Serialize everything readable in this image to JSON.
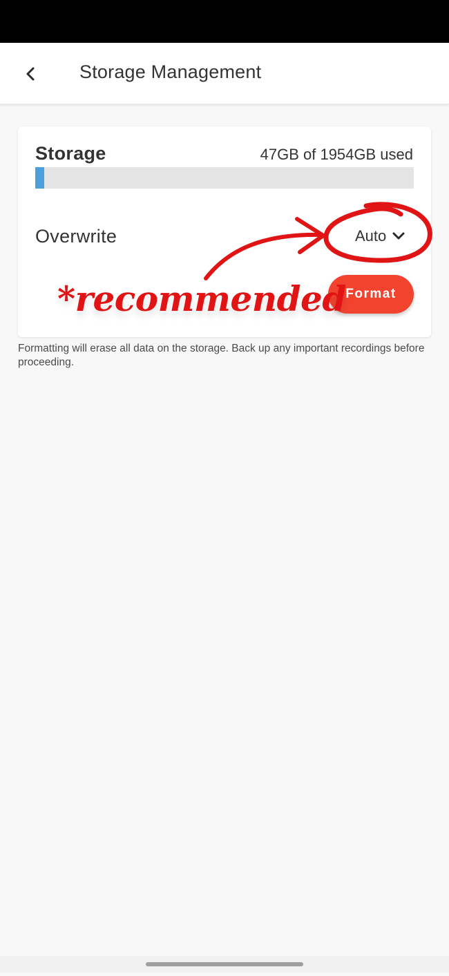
{
  "header": {
    "title": "Storage Management",
    "back_icon": "chevron-left-icon"
  },
  "storage": {
    "label": "Storage",
    "usage_text": "47GB of 1954GB used",
    "used_gb": 47,
    "total_gb": 1954,
    "used_fraction": 0.024,
    "bar_color": "#4a9fdc"
  },
  "overwrite": {
    "label": "Overwrite",
    "value": "Auto",
    "dropdown_icon": "chevron-down-icon"
  },
  "format": {
    "label": "Format",
    "color": "#f2432f"
  },
  "helper_text": "Formatting will erase all data on the storage. Back up any important recordings before proceeding.",
  "annotation": {
    "text": "*recommended",
    "color": "#e01414"
  }
}
